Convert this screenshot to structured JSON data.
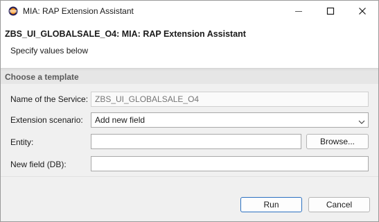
{
  "window": {
    "title": "MIA: RAP Extension Assistant",
    "icon": "eclipse-icon",
    "controls": [
      "minimize-icon",
      "maximize-icon",
      "close-icon"
    ]
  },
  "header": {
    "title": "ZBS_UI_GLOBALSALE_O4: MIA: RAP Extension Assistant",
    "subtitle": "Specify values below"
  },
  "group": {
    "title": "Choose a template"
  },
  "form": {
    "service_label": "Name of the Service:",
    "service_placeholder": "ZBS_UI_GLOBALSALE_O4",
    "scenario_label": "Extension scenario:",
    "scenario_value": "Add new field",
    "entity_label": "Entity:",
    "entity_value": "",
    "browse_label": "Browse...",
    "newfield_label": "New field (DB):",
    "newfield_value": ""
  },
  "buttons": {
    "run_label": "Run",
    "cancel_label": "Cancel"
  },
  "colors": {
    "accent": "#2a6fbf",
    "background": "#f0f0f0",
    "group_header": "#e6e6e6"
  }
}
